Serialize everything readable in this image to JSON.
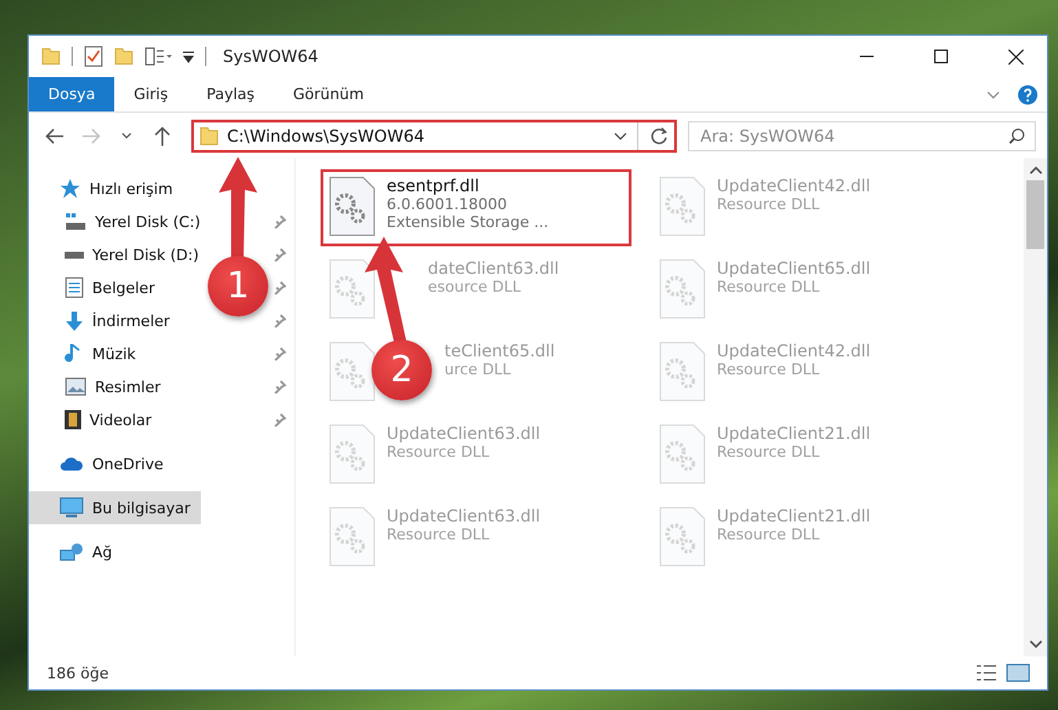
{
  "window": {
    "title": "SysWOW64"
  },
  "tabs": [
    {
      "label": "Dosya",
      "kind": "file",
      "selected": false
    },
    {
      "label": "Giriş",
      "kind": "tab",
      "selected": false
    },
    {
      "label": "Paylaş",
      "kind": "tab",
      "selected": false
    },
    {
      "label": "Görünüm",
      "kind": "tab",
      "selected": false
    }
  ],
  "address": {
    "path": "C:\\Windows\\SysWOW64",
    "highlighted": true
  },
  "search": {
    "placeholder": "Ara: SysWOW64"
  },
  "sidebar": {
    "items": [
      {
        "label": "Hızlı erişim",
        "selected": false,
        "children": [
          {
            "label": "Yerel Disk (C:)",
            "selected": false,
            "pinned": true
          },
          {
            "label": "Yerel Disk (D:)",
            "selected": false,
            "pinned": true
          },
          {
            "label": "Belgeler",
            "selected": false,
            "pinned": true
          },
          {
            "label": "İndirmeler",
            "selected": false,
            "pinned": true
          },
          {
            "label": "Müzik",
            "selected": false,
            "pinned": true
          },
          {
            "label": "Resimler",
            "selected": false,
            "pinned": true
          },
          {
            "label": "Videolar",
            "selected": false,
            "pinned": true
          }
        ]
      },
      {
        "label": "OneDrive",
        "selected": false
      },
      {
        "label": "Bu bilgisayar",
        "selected": true
      },
      {
        "label": "Ağ",
        "selected": false
      }
    ]
  },
  "files": [
    {
      "name": "esentprf.dll",
      "details": [
        "6.0.6001.18000",
        "Extensible Storage ..."
      ],
      "faded": false,
      "highlighted": true
    },
    {
      "name": "UpdateClient42.dll",
      "details": [
        "Resource DLL"
      ],
      "faded": true,
      "highlighted": false
    },
    {
      "name": "dateClient63.dll",
      "details": [
        "esource DLL"
      ],
      "faded": true,
      "highlighted": false
    },
    {
      "name": "UpdateClient65.dll",
      "details": [
        "Resource DLL"
      ],
      "faded": true,
      "highlighted": false
    },
    {
      "name": "teClient65.dll",
      "details": [
        "urce DLL"
      ],
      "faded": true,
      "highlighted": false
    },
    {
      "name": "UpdateClient42.dll",
      "details": [
        "Resource DLL"
      ],
      "faded": true,
      "highlighted": false
    },
    {
      "name": "UpdateClient63.dll",
      "details": [
        "Resource DLL"
      ],
      "faded": true,
      "highlighted": false
    },
    {
      "name": "UpdateClient21.dll",
      "details": [
        "Resource DLL"
      ],
      "faded": true,
      "highlighted": false
    },
    {
      "name": "UpdateClient63.dll",
      "details": [
        "Resource DLL"
      ],
      "faded": true,
      "highlighted": false
    },
    {
      "name": "UpdateClient21.dll",
      "details": [
        "Resource DLL"
      ],
      "faded": true,
      "highlighted": false
    }
  ],
  "callouts": [
    {
      "number": "1"
    },
    {
      "number": "2"
    }
  ],
  "status_bar": {
    "count": "186 öğe"
  }
}
